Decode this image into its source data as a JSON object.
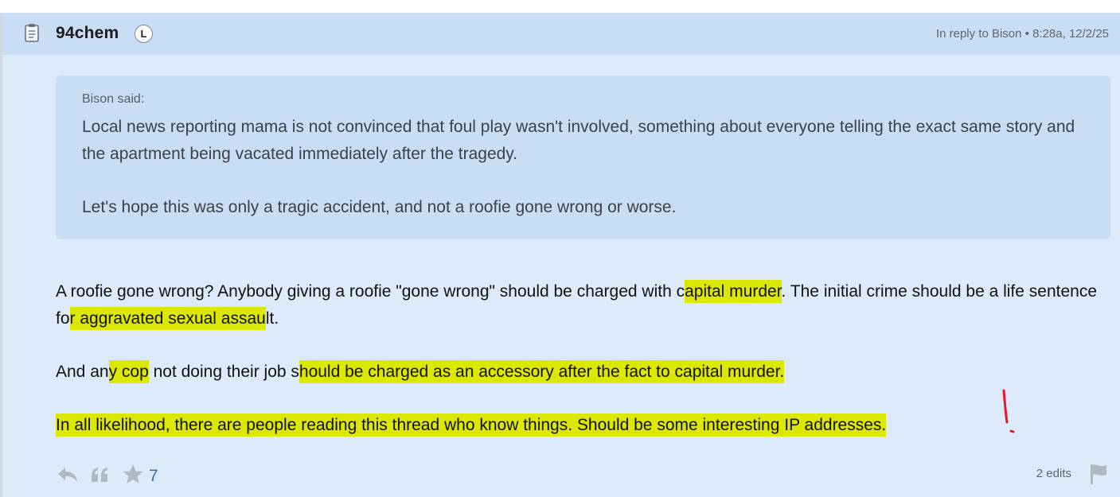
{
  "post": {
    "username": "94chem",
    "badge": "L",
    "meta": "In reply to Bison • 8:28a, 12/2/25",
    "doc_icon": "document-icon"
  },
  "quote": {
    "author": "Bison said:",
    "paragraphs": [
      "Local news reporting mama is not convinced that foul play wasn't involved, something about everyone telling the exact same story and the apartment being vacated immediately after the tragedy.",
      "Let's hope this was only a tragic accident, and not a roofie gone wrong or worse."
    ]
  },
  "content": {
    "p1": {
      "a": "A roofie gone wrong? Anybody giving a roofie \"gone wrong\" should be charged with c",
      "b": "apital murder",
      "c": ". The initial crime should be a life sentence fo",
      "d": "r aggravated sexual assau",
      "e": "lt."
    },
    "p2": {
      "a": "And an",
      "b": "y cop",
      "c": " not doing their job s",
      "d": "hould be charged as an accessory after the fact to capital murder. "
    },
    "p3": {
      "a": "In all likelihood, there are people reading this thread who know things. Should be some interesting IP addresses."
    }
  },
  "colors": {
    "highlight": "#dde800",
    "annotation": "#e8182a",
    "header_bg": "#c9def5",
    "post_bg": "#dceaf9"
  },
  "footer": {
    "reply_icon": "reply-icon",
    "quote_icon": "quote-icon",
    "star_icon": "star-icon",
    "star_count": "7",
    "edits": "2 edits",
    "flag_icon": "flag-icon"
  }
}
